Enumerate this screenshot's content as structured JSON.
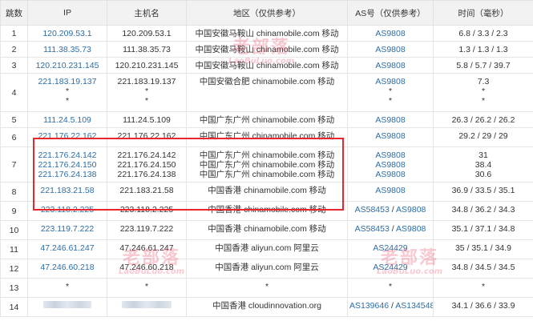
{
  "headers": {
    "hop": "跳数",
    "ip": "IP",
    "host": "主机名",
    "region": "地区（仅供参考）",
    "as": "AS号（仅供参考）",
    "time": "时间（毫秒）"
  },
  "rows": [
    {
      "hop": "1",
      "ips": [
        "120.209.53.1"
      ],
      "hosts": [
        "120.209.53.1"
      ],
      "region": "中国安徽马鞍山 chinamobile.com 移动",
      "as": [
        "AS9808"
      ],
      "times": [
        "6.8 / 3.3 / 2.3"
      ]
    },
    {
      "hop": "2",
      "ips": [
        "111.38.35.73"
      ],
      "hosts": [
        "111.38.35.73"
      ],
      "region": "中国安徽马鞍山 chinamobile.com 移动",
      "as": [
        "AS9808"
      ],
      "times": [
        "1.3 / 1.3 / 1.3"
      ]
    },
    {
      "hop": "3",
      "ips": [
        "120.210.231.145"
      ],
      "hosts": [
        "120.210.231.145"
      ],
      "region": "中国安徽马鞍山 chinamobile.com 移动",
      "as": [
        "AS9808"
      ],
      "times": [
        "5.8 / 5.7 / 39.7"
      ]
    },
    {
      "hop": "4",
      "ips": [
        "221.183.19.137",
        "*",
        "*"
      ],
      "hosts": [
        "221.183.19.137",
        "*",
        "*"
      ],
      "region": "中国安徽合肥 chinamobile.com 移动",
      "as": [
        "AS9808",
        "*",
        "*"
      ],
      "times": [
        "7.3",
        "*",
        "*"
      ]
    },
    {
      "hop": "5",
      "ips": [
        "111.24.5.109"
      ],
      "hosts": [
        "111.24.5.109"
      ],
      "region": "中国广东广州 chinamobile.com 移动",
      "as": [
        "AS9808"
      ],
      "times": [
        "26.3 / 26.2 / 26.2"
      ]
    },
    {
      "hop": "6",
      "ips": [
        "221.176.22.162"
      ],
      "hosts": [
        "221.176.22.162"
      ],
      "region": "中国广东广州 chinamobile.com 移动",
      "as": [
        "AS9808"
      ],
      "times": [
        "29.2 / 29 / 29"
      ]
    },
    {
      "hop": "7",
      "ips": [
        "221.176.24.142",
        "221.176.24.150",
        "221.176.24.138"
      ],
      "hosts": [
        "221.176.24.142",
        "221.176.24.150",
        "221.176.24.138"
      ],
      "regions": [
        "中国广东广州 chinamobile.com 移动",
        "中国广东广州 chinamobile.com 移动",
        "中国广东广州 chinamobile.com 移动"
      ],
      "as": [
        "AS9808",
        "AS9808",
        "AS9808"
      ],
      "times": [
        "31",
        "38.4",
        "30.6"
      ]
    },
    {
      "hop": "8",
      "ips": [
        "221.183.21.58"
      ],
      "hosts": [
        "221.183.21.58"
      ],
      "region": "中国香港 chinamobile.com 移动",
      "as": [
        "AS9808"
      ],
      "times": [
        "36.9 / 33.5 / 35.1"
      ]
    },
    {
      "hop": "9",
      "ips": [
        "223.118.2.225"
      ],
      "hosts": [
        "223.118.2.225"
      ],
      "region": "中国香港 chinamobile.com 移动",
      "as_pair": [
        "AS58453",
        "AS9808"
      ],
      "times": [
        "34.8 / 36.2 / 34.3"
      ]
    },
    {
      "hop": "10",
      "ips": [
        "223.119.7.222"
      ],
      "hosts": [
        "223.119.7.222"
      ],
      "region": "中国香港 chinamobile.com 移动",
      "as_pair": [
        "AS58453",
        "AS9808"
      ],
      "times": [
        "35.1 / 37.1 / 34.8"
      ]
    },
    {
      "hop": "11",
      "ips": [
        "47.246.61.247"
      ],
      "hosts": [
        "47.246.61.247"
      ],
      "region": "中国香港 aliyun.com 阿里云",
      "as": [
        "AS24429"
      ],
      "times": [
        "35 / 35.1 / 34.9"
      ]
    },
    {
      "hop": "12",
      "ips": [
        "47.246.60.218"
      ],
      "hosts": [
        "47.246.60.218"
      ],
      "region": "中国香港 aliyun.com 阿里云",
      "as": [
        "AS24429"
      ],
      "times": [
        "34.8 / 34.5 / 34.5"
      ]
    },
    {
      "hop": "13",
      "ips": [
        "*"
      ],
      "hosts": [
        "*"
      ],
      "region": "*",
      "as": [
        "*"
      ],
      "times": [
        "*"
      ]
    },
    {
      "hop": "14",
      "ips": [],
      "hosts": [],
      "region": "中国香港 cloudinnovation.org",
      "as_pair": [
        "AS139646",
        "AS134548"
      ],
      "times": [
        "34.1 / 36.6 / 33.9"
      ]
    }
  ],
  "watermark": {
    "big": "老部落",
    "small": "LaoBuLuo.com"
  },
  "colors": {
    "link": "#2e6da4",
    "highlight": "#e8262b",
    "header_bg": "#f2f2f2"
  }
}
